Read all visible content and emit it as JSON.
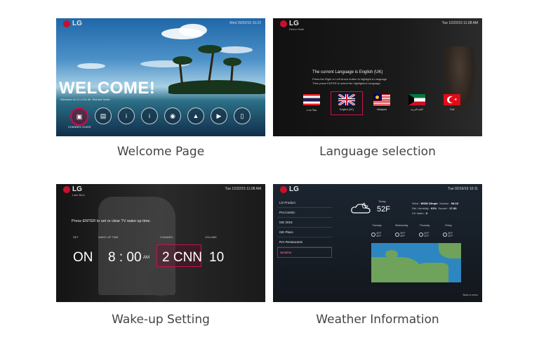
{
  "panels": {
    "welcome": {
      "brand": "LG",
      "datetime": "Wed 26/02/16 15:22",
      "headline": "WELCOME!",
      "subtext": "Welcome to LG U-DL Mr. Richard Smith",
      "selected_icon_label": "CHANNEL GUIDE",
      "icons": [
        "tv-guide-icon",
        "document-icon",
        "info-icon",
        "info-icon",
        "globe-icon",
        "shirt-icon",
        "media-icon",
        "phone-icon"
      ],
      "caption": "Welcome Page"
    },
    "language": {
      "brand": "LG",
      "brand_sub": "Demo Hotel",
      "datetime": "Tue 12/22/15 11:08 AM",
      "current": "The current Language is English (UK)",
      "hint1": "Press the Right or Left Arrow button to highlight a Language",
      "hint2": "Then press ENTER to select the highlighted Language.",
      "flags": [
        {
          "label": "ภาษาไทย",
          "country": "thailand"
        },
        {
          "label": "English (UK)",
          "country": "uk"
        },
        {
          "label": "Malaysia",
          "country": "malaysia"
        },
        {
          "label": "اللغة العربية",
          "country": "kuwait"
        },
        {
          "label": "Türk",
          "country": "turkey"
        }
      ],
      "caption": "Language selection"
    },
    "wakeup": {
      "brand": "LG",
      "brand_sub": "Lake Blvd",
      "datetime": "Tue 12/22/15 11:08 AM",
      "hint": "Press ENTER to set or clear TV wake up time.",
      "headers": {
        "set": "SET",
        "time": "WAKE UP TIME",
        "channel": "CHANNEL",
        "volume": "VOLUME"
      },
      "values": {
        "set": "ON",
        "time": "8 : 00",
        "ampm": "AM",
        "channel": "2 CNN",
        "volume": "10"
      },
      "caption": "Wake-up Setting"
    },
    "weather": {
      "brand": "LG",
      "datetime": "Tue 02/16/16 10:11",
      "menu": [
        "LG Product",
        "Pro:Centric",
        "ISE 2016",
        "ISE Place",
        "RAI Restaurants",
        "Weather"
      ],
      "selected_menu": "Weather",
      "today": "Today",
      "temp": "52F",
      "stats": {
        "wind_label": "Wind",
        "wind": "WSW 23mph",
        "sunrise_label": "Sunrise",
        "sunrise": "08:16",
        "humidity_label": "Rel. Humidity",
        "humidity": "61%",
        "sunset_label": "Sunset",
        "sunset": "17:33",
        "uv_label": "UV Index",
        "uv": "0"
      },
      "days": [
        "Tuesday",
        "Wednesday",
        "Thursday",
        "Friday"
      ],
      "forecast": [
        "40°F 45°F",
        "39°F 45°F",
        "40°F 43°F",
        "36°F 43°F"
      ],
      "footer": "Back to menu",
      "caption": "Weather Information"
    }
  },
  "colors": {
    "accent": "#c8104e",
    "lg_red": "#c8102e"
  }
}
